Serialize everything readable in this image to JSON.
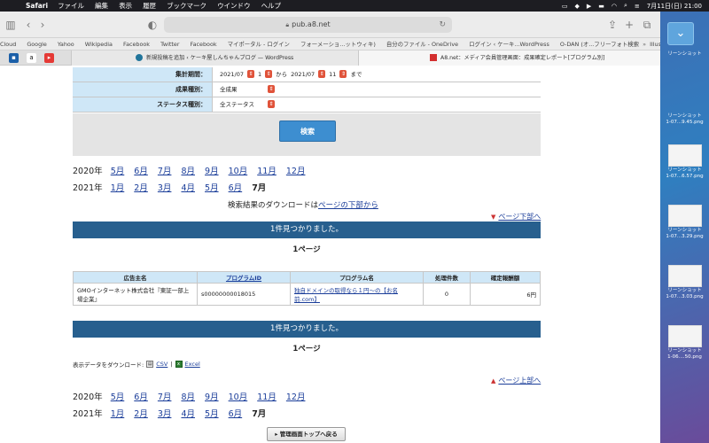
{
  "menubar": {
    "app_name": "Safari",
    "menus": [
      "ファイル",
      "編集",
      "表示",
      "履歴",
      "ブックマーク",
      "ウインドウ",
      "ヘルプ"
    ],
    "clock": "7月11日(日) 21:00"
  },
  "browser": {
    "address": "pub.a8.net",
    "bookmarks": [
      "Cloud",
      "Google",
      "Yahoo",
      "Wikipedia",
      "Facebook",
      "Twitter",
      "Facebook",
      "マイポータル - ログイン",
      "フォーメーショ...ットウィキ)",
      "自分のファイル - OneDrive",
      "ログイン ‹ ケーキ...WordPress",
      "O-DAN (オ...フリーフォト検索",
      "Illustrations | unDraw"
    ],
    "tabs": [
      {
        "label": "新規投稿を追加 ‹ ケーキ屋しんちゃんブログ — WordPress"
      },
      {
        "label": "A8.net：メディア会員管理画面：成果確定レポート[プログラム別]"
      }
    ]
  },
  "search_form": {
    "period_label": "集計期間：",
    "start_year_month": "2021/07",
    "start_day": "1",
    "from_text": "から",
    "end_year_month": "2021/07",
    "end_day": "11",
    "until_text": "まで",
    "result_type_label": "成果種別：",
    "result_type_value": "全成果",
    "status_type_label": "ステータス種別：",
    "status_type_value": "全ステータス",
    "search_button": "検索"
  },
  "year_links": [
    {
      "year": "2020年",
      "months": [
        "5月",
        "6月",
        "7月",
        "8月",
        "9月",
        "10月",
        "11月",
        "12月"
      ],
      "current": ""
    },
    {
      "year": "2021年",
      "months": [
        "1月",
        "2月",
        "3月",
        "4月",
        "5月",
        "6月"
      ],
      "current": "7月"
    }
  ],
  "download_note": {
    "text": "検索結果のダウンロードは",
    "link": "ページの下部から"
  },
  "page_bottom_link": "ページ下部へ",
  "page_top_link": "ページ上部へ",
  "found_text": "1件見つかりました。",
  "page_count": "1ページ",
  "results": {
    "headers": [
      "広告主名",
      "プログラムID",
      "プログラム名",
      "処理件数",
      "確定報酬額"
    ],
    "rows": [
      {
        "advertiser": "GMOインターネット株式会社『東証一部上場企業』",
        "program_id": "s00000000018015",
        "program_name": "独自ドメインの取得なら１円〜の【お名前.com】",
        "count": "0",
        "amount": "6円"
      }
    ]
  },
  "download": {
    "label": "表示データをダウンロード:",
    "csv": "CSV",
    "separator": "|",
    "excel": "Excel"
  },
  "back_button": "管理画面トップへ戻る",
  "desktop_files": [
    {
      "name": "リーンショット"
    },
    {
      "name": "リーンショット\n1-07...9.45.png"
    },
    {
      "name": "リーンショット\n1-07...6.57.png"
    },
    {
      "name": "リーンショット\n1-07...3.29.png"
    },
    {
      "name": "リーンショット\n1-07...3.03.png"
    },
    {
      "name": "リーンショット\n1-06....50.png"
    }
  ]
}
